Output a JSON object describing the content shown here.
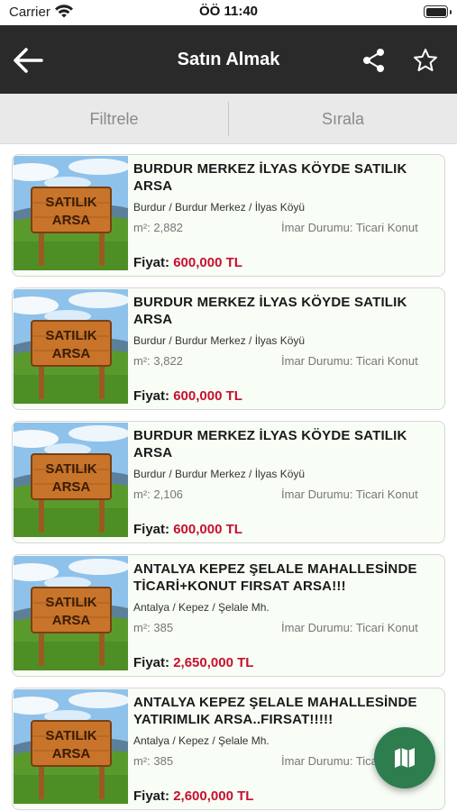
{
  "status_bar": {
    "carrier": "Carrier",
    "time": "ÖÖ 11:40"
  },
  "nav": {
    "title": "Satın Almak",
    "back_icon": "arrow-left-icon",
    "share_icon": "share-icon",
    "favorite_icon": "star-outline-icon"
  },
  "segments": {
    "filter": "Filtrele",
    "sort": "Sırala"
  },
  "listings": [
    {
      "title": "BURDUR MERKEZ İLYAS KÖYDE SATILIK ARSA",
      "location": "Burdur / Burdur Merkez / İlyas Köyü",
      "area": "m²: 2,882",
      "zoning": "İmar Durumu: Ticari Konut",
      "price_label": "Fiyat:",
      "price": "600,000 TL",
      "sign_line1": "SATILIK",
      "sign_line2": "ARSA"
    },
    {
      "title": "BURDUR MERKEZ İLYAS KÖYDE SATILIK ARSA",
      "location": "Burdur / Burdur Merkez / İlyas Köyü",
      "area": "m²: 3,822",
      "zoning": "İmar Durumu: Ticari Konut",
      "price_label": "Fiyat:",
      "price": "600,000 TL",
      "sign_line1": "SATILIK",
      "sign_line2": "ARSA"
    },
    {
      "title": "BURDUR MERKEZ İLYAS KÖYDE SATILIK ARSA",
      "location": "Burdur / Burdur Merkez / İlyas Köyü",
      "area": "m²: 2,106",
      "zoning": "İmar Durumu: Ticari Konut",
      "price_label": "Fiyat:",
      "price": "600,000 TL",
      "sign_line1": "SATILIK",
      "sign_line2": "ARSA"
    },
    {
      "title": "ANTALYA KEPEZ ŞELALE MAHALLESİNDE TİCARİ+KONUT FIRSAT ARSA!!!",
      "location": "Antalya / Kepez / Şelale Mh.",
      "area": "m²: 385",
      "zoning": "İmar Durumu: Ticari Konut",
      "price_label": "Fiyat:",
      "price": "2,650,000 TL",
      "sign_line1": "SATILIK",
      "sign_line2": "ARSA"
    },
    {
      "title": "ANTALYA KEPEZ ŞELALE MAHALLESİNDE YATIRIMLIK ARSA..FIRSAT!!!!!",
      "location": "Antalya / Kepez / Şelale Mh.",
      "area": "m²: 385",
      "zoning": "İmar Durumu: Ticari Konut",
      "price_label": "Fiyat:",
      "price": "2,600,000 TL",
      "sign_line1": "SATILIK",
      "sign_line2": "ARSA"
    }
  ],
  "fab": {
    "icon": "map-icon"
  },
  "colors": {
    "nav_bg": "#2a2a2a",
    "price": "#c8102e",
    "fab": "#2e7d4f",
    "card_bg": "#f8fdf6"
  }
}
